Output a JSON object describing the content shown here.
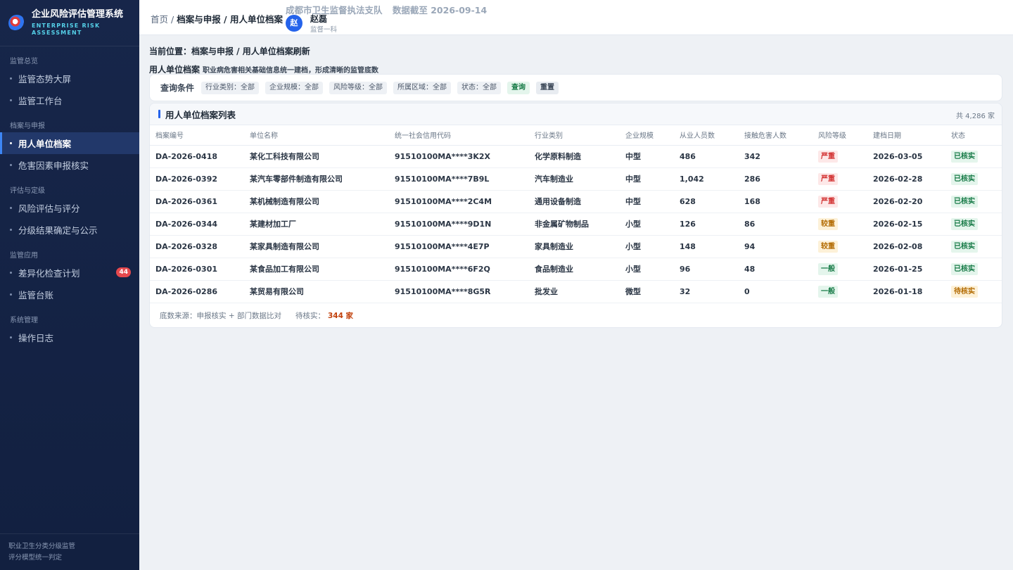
{
  "brand": {
    "title": "企业风险评估管理系统",
    "subtitle_line1": "ENTERPRISE RISK",
    "subtitle_line2": "ASSESSMENT"
  },
  "sidebar": {
    "groups": [
      {
        "title": "监管总览",
        "items": [
          {
            "label": "监管态势大屏"
          },
          {
            "label": "监管工作台"
          }
        ]
      },
      {
        "title": "档案与申报",
        "items": [
          {
            "label": "用人单位档案",
            "active": true
          },
          {
            "label": "危害因素申报核实"
          }
        ]
      },
      {
        "title": "评估与定级",
        "items": [
          {
            "label": "风险评估与评分"
          },
          {
            "label": "分级结果确定与公示"
          }
        ]
      },
      {
        "title": "监管应用",
        "items": [
          {
            "label": "差异化检查计划",
            "badge": "44"
          },
          {
            "label": "监管台账"
          }
        ]
      },
      {
        "title": "系统管理",
        "items": [
          {
            "label": "操作日志"
          }
        ]
      }
    ],
    "footer_line1": "职业卫生分类分级监管",
    "footer_line2": "评分模型统一判定"
  },
  "topbar": {
    "crumb_home": "首页",
    "crumb_sep": " / ",
    "crumb_path": "档案与申报 / 用人单位档案",
    "org": "成都市卫生监督执法支队",
    "data_date": "数据截至 2026-09-14",
    "user_initial": "赵",
    "user_name": "赵磊",
    "user_role": "监督一科"
  },
  "page": {
    "location": "当前位置：档案与申报 / 用人单位档案刷新",
    "section_title": "用人单位档案",
    "section_desc": "职业病危害相关基础信息统一建档，形成清晰的监管底数"
  },
  "filters": {
    "label": "查询条件",
    "chips": [
      "行业类别：全部",
      "企业规模：全部",
      "风险等级：全部",
      "所属区域：全部",
      "状态：全部"
    ],
    "query_label": "查询",
    "reset_label": "重置"
  },
  "table": {
    "title": "用人单位档案列表",
    "count": "共 4,286 家",
    "columns": [
      "档案编号",
      "单位名称",
      "统一社会信用代码",
      "行业类别",
      "企业规模",
      "从业人员数",
      "接触危害人数",
      "风险等级",
      "建档日期",
      "状态"
    ],
    "rows": [
      [
        "DA-2026-0418",
        "某化工科技有限公司",
        "91510100MA****3K2X",
        "化学原料制造",
        "中型",
        "486",
        "342",
        "严重",
        "2026-03-05",
        "已核实"
      ],
      [
        "DA-2026-0392",
        "某汽车零部件制造有限公司",
        "91510100MA****7B9L",
        "汽车制造业",
        "中型",
        "1,042",
        "286",
        "严重",
        "2026-02-28",
        "已核实"
      ],
      [
        "DA-2026-0361",
        "某机械制造有限公司",
        "91510100MA****2C4M",
        "通用设备制造",
        "中型",
        "628",
        "168",
        "严重",
        "2026-02-20",
        "已核实"
      ],
      [
        "DA-2026-0344",
        "某建材加工厂",
        "91510100MA****9D1N",
        "非金属矿物制品",
        "小型",
        "126",
        "86",
        "较重",
        "2026-02-15",
        "已核实"
      ],
      [
        "DA-2026-0328",
        "某家具制造有限公司",
        "91510100MA****4E7P",
        "家具制造业",
        "小型",
        "148",
        "94",
        "较重",
        "2026-02-08",
        "已核实"
      ],
      [
        "DA-2026-0301",
        "某食品加工有限公司",
        "91510100MA****6F2Q",
        "食品制造业",
        "小型",
        "96",
        "48",
        "一般",
        "2026-01-25",
        "已核实"
      ],
      [
        "DA-2026-0286",
        "某贸易有限公司",
        "91510100MA****8G5R",
        "批发业",
        "微型",
        "32",
        "0",
        "一般",
        "2026-01-18",
        "待核实"
      ]
    ],
    "foot_source": "底数来源：申报核实 + 部门数据比对",
    "foot_pending_label": "待核实：",
    "foot_pending_value": "344 家"
  },
  "colors": {
    "sidebar_bg": "#17264a",
    "accent": "#2563eb",
    "risk_severe": "#d23030",
    "risk_mid": "#b26a00",
    "risk_low": "#167a46"
  }
}
